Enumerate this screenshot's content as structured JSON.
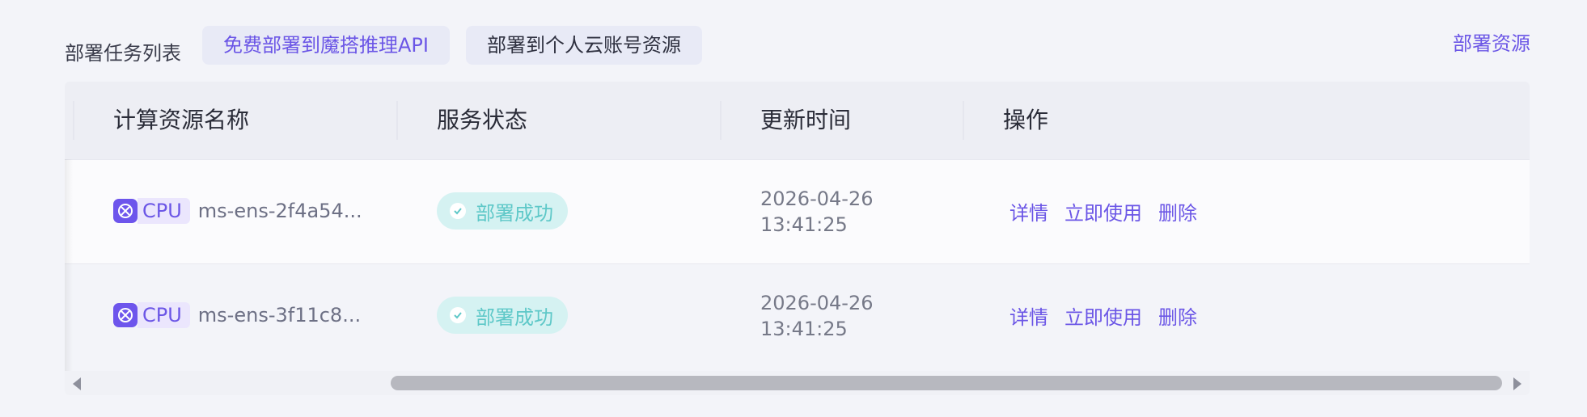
{
  "header": {
    "title": "部署任务列表",
    "tabs": [
      {
        "label": "免费部署到魔搭推理API",
        "active": true
      },
      {
        "label": "部署到个人云账号资源",
        "active": false
      }
    ],
    "deploy_resource_link": "部署资源"
  },
  "table": {
    "columns": [
      "计算资源名称",
      "服务状态",
      "更新时间",
      "操作"
    ],
    "rows": [
      {
        "resource_icon": "cpu-chip-icon",
        "resource_type": "CPU",
        "resource_name": "ms-ens-2f4a54...",
        "status": "部署成功",
        "updated_date": "2026-04-26",
        "updated_time": "13:41:25",
        "actions": [
          "详情",
          "立即使用",
          "删除"
        ]
      },
      {
        "resource_icon": "cpu-chip-icon",
        "resource_type": "CPU",
        "resource_name": "ms-ens-3f11c8...",
        "status": "部署成功",
        "updated_date": "2026-04-26",
        "updated_time": "13:41:25",
        "actions": [
          "详情",
          "立即使用",
          "删除"
        ]
      }
    ]
  },
  "colors": {
    "accent": "#6b56e6",
    "success_text": "#5ec8c8",
    "success_bg": "#d5f2f2",
    "background": "#f3f4f9"
  }
}
